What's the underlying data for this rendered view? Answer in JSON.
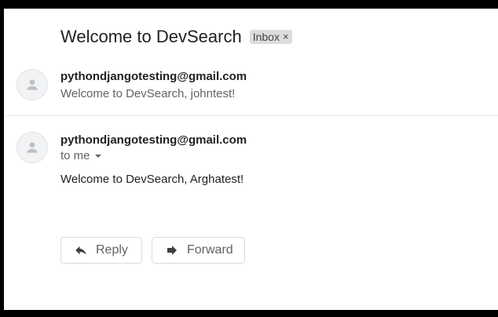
{
  "thread": {
    "subject": "Welcome to DevSearch",
    "label": "Inbox",
    "label_remove": "×"
  },
  "messages": [
    {
      "sender": "pythondjangotesting@gmail.com",
      "snippet": "Welcome to DevSearch, johntest!"
    },
    {
      "sender": "pythondjangotesting@gmail.com",
      "recipient_line": "to me",
      "body": "Welcome to DevSearch, Arghatest!"
    }
  ],
  "actions": {
    "reply_label": "Reply",
    "forward_label": "Forward"
  },
  "icons": {
    "avatar": "person-icon",
    "reply": "reply-arrow-icon",
    "forward": "forward-arrow-icon",
    "details": "caret-down-icon"
  },
  "colors": {
    "text_primary": "#202124",
    "text_secondary": "#5f6368",
    "chip_bg": "#dddddd"
  }
}
